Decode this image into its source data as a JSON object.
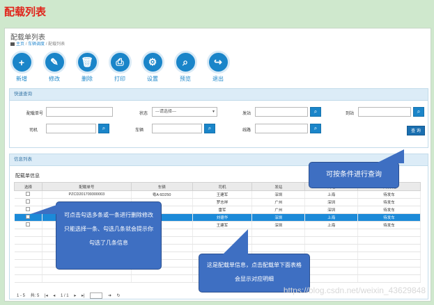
{
  "page_heading": "配载列表",
  "panel_title": "配载单列表",
  "breadcrumb": {
    "home": "主页",
    "sep": "/",
    "level2": "车辆调度",
    "current": "配载列表"
  },
  "toolbar": [
    {
      "label": "新增",
      "glyph": "+"
    },
    {
      "label": "修改",
      "glyph": "✎"
    },
    {
      "label": "删除",
      "glyph": "🗑"
    },
    {
      "label": "打印",
      "glyph": "⎙"
    },
    {
      "label": "设置",
      "glyph": "⚙"
    },
    {
      "label": "预览",
      "glyph": "⌕"
    },
    {
      "label": "退出",
      "glyph": "↪"
    }
  ],
  "quick_query": {
    "title": "快速查询",
    "labels": {
      "order_no": "配载单号",
      "status": "状态",
      "origin": "发站",
      "destination": "到站",
      "driver": "司机",
      "vehicle": "车辆",
      "route": "线路"
    },
    "status_placeholder": "---请选择---",
    "search_glyph": "⌕",
    "query_button": "查 询"
  },
  "info_list": {
    "title": "信息列表",
    "grid_title": "配载单信息",
    "columns": [
      "选择",
      "配载单号",
      "车辆",
      "司机",
      "发站",
      "到站",
      "车辆状态"
    ],
    "rows": [
      [
        "PZCD201709300003",
        "粤A 6D250",
        "王建军",
        "深圳",
        "上海",
        "待发车"
      ],
      [
        "",
        "",
        "罗志祥",
        "广州",
        "深圳",
        "待发车"
      ],
      [
        "",
        "",
        "雷军",
        "广州",
        "深圳",
        "待发车"
      ],
      [
        "",
        "",
        "刘德华",
        "深圳",
        "上海",
        "待发车"
      ],
      [
        "",
        "",
        "王建军",
        "深圳",
        "上海",
        "待发车"
      ]
    ],
    "selected_row": 3
  },
  "pager": {
    "range": "1 - 5",
    "total": "共: 5",
    "page": "1 / 1"
  },
  "callouts": {
    "query_tip": "可按条件进行查询",
    "select_tip": "可点击勾选多条或一条进行删除修改只能选择一条、勾选几条就会提示你勾选了几条信息",
    "detail_tip": "这是配载单信息，点击配载单下面表格会显示对应明细"
  },
  "watermark": "https://blog.csdn.net/weixin_43629848",
  "colors": {
    "accent": "#1a85c9",
    "callout": "#3e6fc2",
    "selected_row": "#1c8ad8",
    "heading": "#e0241b"
  }
}
